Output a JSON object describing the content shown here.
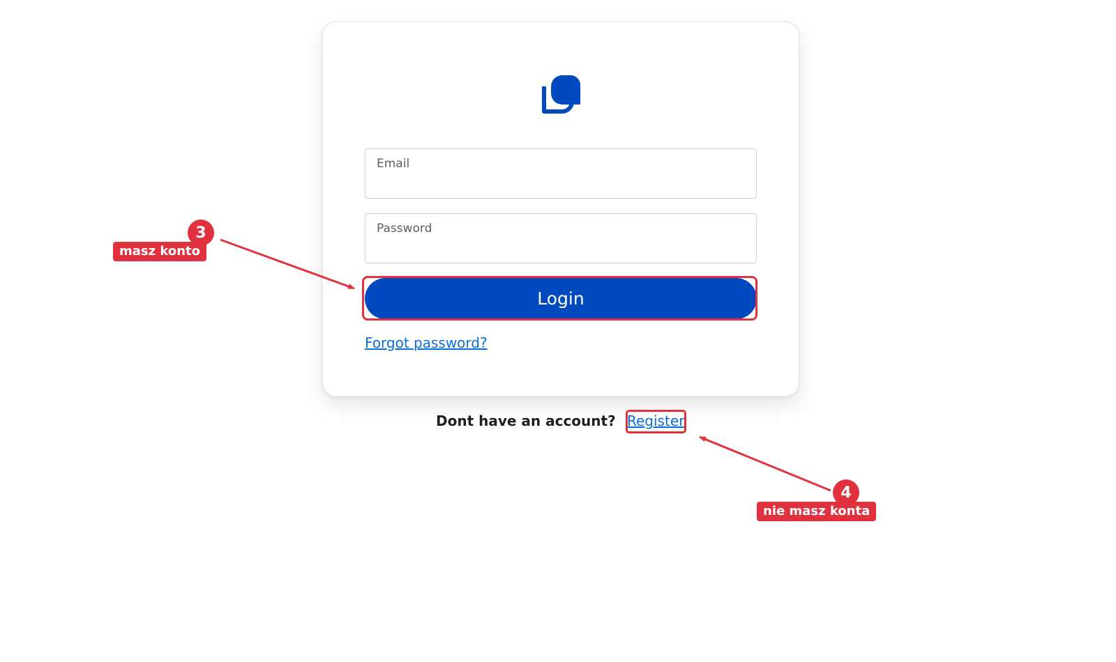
{
  "app": {
    "logo": "chat-bubbles-logo"
  },
  "login_form": {
    "email": {
      "label": "Email",
      "value": ""
    },
    "password": {
      "label": "Password",
      "value": ""
    },
    "login_label": "Login",
    "forgot_password_label": "Forgot password?"
  },
  "register_prompt": {
    "text": "Dont have an account?",
    "link_label": "Register"
  },
  "annotations": [
    {
      "number": "3",
      "label": "masz konto",
      "target": "login-button"
    },
    {
      "number": "4",
      "label": "nie masz konta",
      "target": "register-link"
    }
  ],
  "colors": {
    "primary": "#0049bf",
    "link": "#0a6ed8",
    "annotation": "#e0323e",
    "card_border": "#e3e3e3"
  }
}
